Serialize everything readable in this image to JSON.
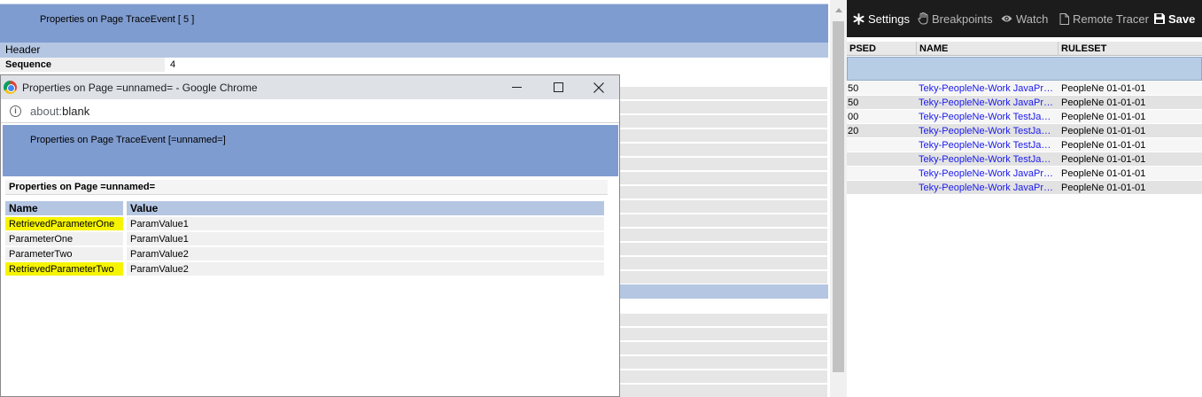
{
  "background_page": {
    "banner_title": "Properties on Page TraceEvent [ 5 ]",
    "section_header": "Header",
    "sequence_label": "Sequence",
    "sequence_value": "4"
  },
  "tracer": {
    "toolbar": {
      "settings": "Settings",
      "breakpoints": "Breakpoints",
      "watch": "Watch",
      "remote_tracer": "Remote Tracer",
      "save": "Save"
    },
    "columns": [
      "PSED",
      "NAME",
      "RULESET"
    ],
    "rows": [
      {
        "elapsed": "50",
        "name": "Teky-PeopleNe-Work JavaPractice",
        "ruleset": "PeopleNe 01-01-01"
      },
      {
        "elapsed": "50",
        "name": "Teky-PeopleNe-Work JavaPractice",
        "ruleset": "PeopleNe 01-01-01"
      },
      {
        "elapsed": "00",
        "name": "Teky-PeopleNe-Work TestJavaAct",
        "ruleset": "PeopleNe 01-01-01"
      },
      {
        "elapsed": "20",
        "name": "Teky-PeopleNe-Work TestJavaAct",
        "ruleset": "PeopleNe 01-01-01"
      },
      {
        "elapsed": "",
        "name": "Teky-PeopleNe-Work TestJavaAct",
        "ruleset": "PeopleNe 01-01-01"
      },
      {
        "elapsed": "",
        "name": "Teky-PeopleNe-Work TestJavaAct",
        "ruleset": "PeopleNe 01-01-01"
      },
      {
        "elapsed": "",
        "name": "Teky-PeopleNe-Work JavaPractice",
        "ruleset": "PeopleNe 01-01-01"
      },
      {
        "elapsed": "",
        "name": "Teky-PeopleNe-Work JavaPractice",
        "ruleset": "PeopleNe 01-01-01"
      }
    ]
  },
  "popup": {
    "window_title": "Properties on Page =unnamed= - Google Chrome",
    "url_prefix": "about:",
    "url_path": "blank",
    "banner_title": "Properties on Page TraceEvent [=unnamed=]",
    "subtitle": "Properties on Page =unnamed=",
    "columns": {
      "name": "Name",
      "value": "Value"
    },
    "rows": [
      {
        "name": "RetrievedParameterOne",
        "value": "ParamValue1",
        "highlighted": true
      },
      {
        "name": "ParameterOne",
        "value": "ParamValue1",
        "highlighted": false
      },
      {
        "name": "ParameterTwo",
        "value": "ParamValue2",
        "highlighted": false
      },
      {
        "name": "RetrievedParameterTwo",
        "value": "ParamValue2",
        "highlighted": true
      }
    ]
  },
  "colors": {
    "banner": "#7f9cd0",
    "header_band": "#b4c6e2",
    "highlight": "#f6f400",
    "toolbar_bg": "#1c1c1c",
    "link": "#1a1aee"
  },
  "icons": {
    "settings": "asterisk-gear-icon",
    "breakpoints": "hand-icon",
    "watch": "eye-icon",
    "remote_tracer": "document-icon",
    "save": "floppy-disk-icon",
    "chrome": "chrome-logo-icon",
    "info": "info-circle-icon",
    "minimize": "minimize-icon",
    "maximize": "maximize-icon",
    "close": "close-icon"
  }
}
